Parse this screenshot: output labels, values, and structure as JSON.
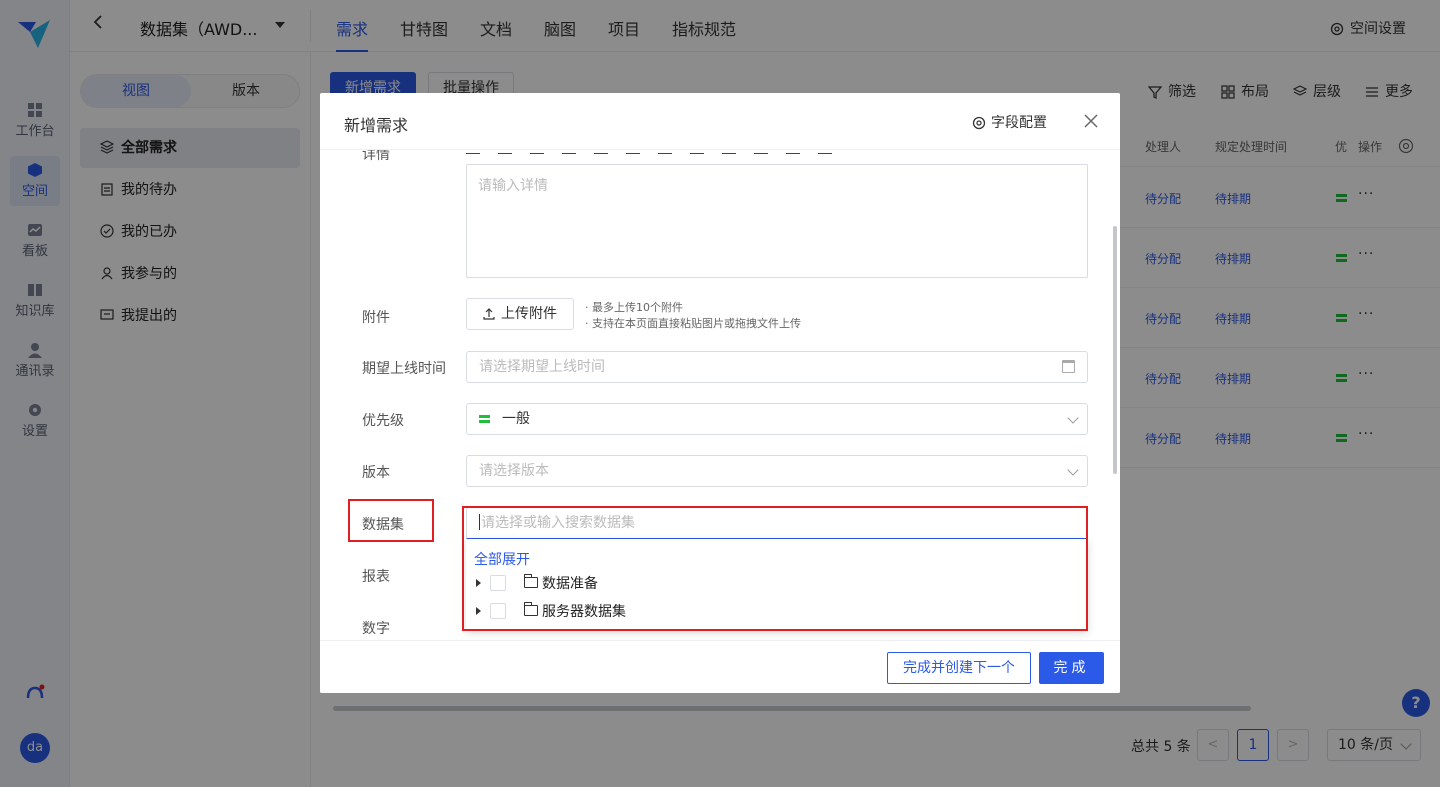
{
  "rail": {
    "items": [
      {
        "label": "工作台",
        "icon": "grid-icon"
      },
      {
        "label": "空间",
        "icon": "cube-icon"
      },
      {
        "label": "看板",
        "icon": "chart-icon"
      },
      {
        "label": "知识库",
        "icon": "book-icon"
      },
      {
        "label": "通讯录",
        "icon": "person-icon"
      },
      {
        "label": "设置",
        "icon": "gear-icon"
      }
    ],
    "avatar": "da"
  },
  "topbar": {
    "dataset_title": "数据集（AWD...",
    "tabs": [
      "需求",
      "甘特图",
      "文档",
      "脑图",
      "项目",
      "指标规范"
    ],
    "active_tab": "需求",
    "space_settings": "空间设置"
  },
  "sidebar": {
    "segments": [
      "视图",
      "版本"
    ],
    "items": [
      {
        "label": "全部需求",
        "icon": "layers-icon"
      },
      {
        "label": "我的待办",
        "icon": "clipboard-icon"
      },
      {
        "label": "我的已办",
        "icon": "check-circle-icon"
      },
      {
        "label": "我参与的",
        "icon": "people-icon"
      },
      {
        "label": "我提出的",
        "icon": "message-icon"
      }
    ]
  },
  "main": {
    "add_button": "新增需求",
    "batch_button": "批量操作",
    "tools": [
      "筛选",
      "布局",
      "层级",
      "更多"
    ],
    "headers": {
      "assignee": "处理人",
      "due": "规定处理时间",
      "priority": "优",
      "ops": "操作"
    },
    "rows": [
      {
        "assignee": "待分配",
        "due": "待排期",
        "ops": "···"
      },
      {
        "assignee": "待分配",
        "due": "待排期",
        "ops": "···"
      },
      {
        "assignee": "待分配",
        "due": "待排期",
        "ops": "···"
      },
      {
        "assignee": "待分配",
        "due": "待排期",
        "ops": "···"
      },
      {
        "assignee": "待分配",
        "due": "待排期",
        "ops": "···"
      }
    ],
    "pager": {
      "total": "总共 5 条",
      "current": "1",
      "page_size": "10 条/页",
      "prev": "<",
      "next": ">"
    },
    "help": "?"
  },
  "modal": {
    "title": "新增需求",
    "field_config": "字段配置",
    "close": "X",
    "fields": {
      "detail_label": "详情",
      "detail_placeholder": "请输入详情",
      "attachment_label": "附件",
      "upload_button": "上传附件",
      "upload_tips": [
        "· 最多上传10个附件",
        "· 支持在本页面直接粘贴图片或拖拽文件上传"
      ],
      "expected_label": "期望上线时间",
      "expected_placeholder": "请选择期望上线时间",
      "priority_label": "优先级",
      "priority_value": "一般",
      "version_label": "版本",
      "version_placeholder": "请选择版本",
      "dataset_label": "数据集",
      "dataset_placeholder": "请选择或输入搜索数据集",
      "report_label": "报表",
      "number_label": "数字"
    },
    "dropdown": {
      "expand_all": "全部展开",
      "nodes": [
        "数据准备",
        "服务器数据集"
      ]
    },
    "footer": {
      "create_next": "完成并创建下一个",
      "done": "完成"
    }
  },
  "colors": {
    "primary": "#2b59e8",
    "priority_green": "#1fbf3a",
    "highlight_red": "#e02020"
  }
}
